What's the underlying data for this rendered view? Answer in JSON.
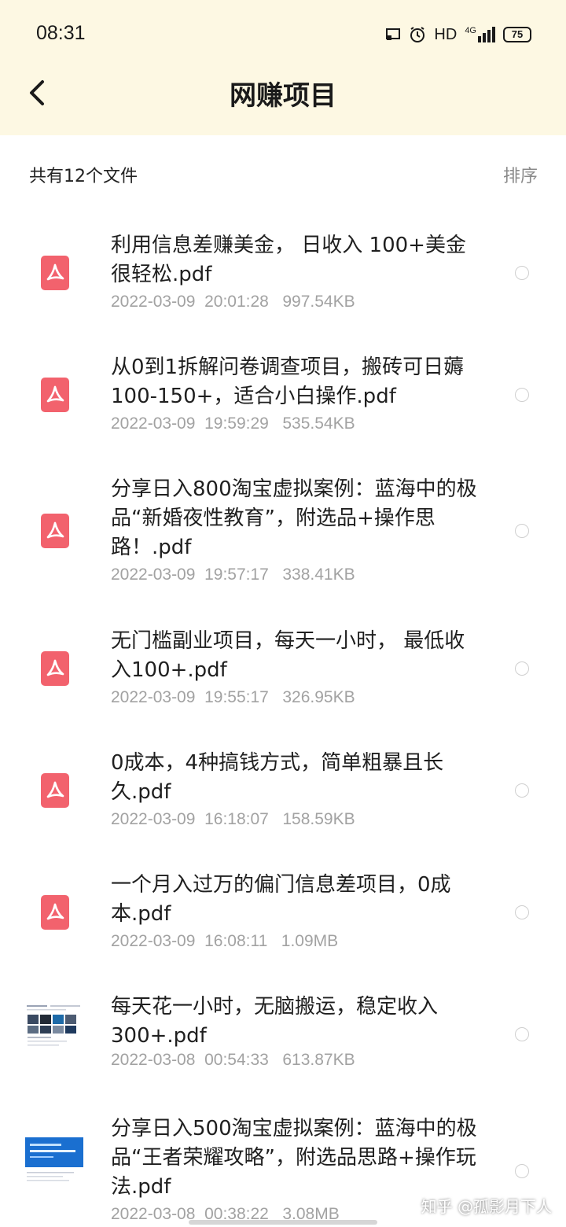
{
  "status": {
    "time": "08:31",
    "network": "HD",
    "signal": "4G",
    "battery": "75"
  },
  "header": {
    "title": "网赚项目"
  },
  "summary": {
    "count_text": "共有12个文件",
    "sort_label": "排序"
  },
  "files": [
    {
      "name": "利用信息差赚美金， 日收入 100+美金很轻松.pdf",
      "meta": "2022-03-09  20:01:28   997.54KB",
      "icon": "pdf-icon"
    },
    {
      "name": "从0到1拆解问卷调查项目，搬砖可日薅100-150+，适合小白操作.pdf",
      "meta": "2022-03-09  19:59:29   535.54KB",
      "icon": "pdf-icon"
    },
    {
      "name": "分享日入800淘宝虚拟案例：蓝海中的极品“新婚夜性教育”，附选品+操作思路！.pdf",
      "meta": "2022-03-09  19:57:17   338.41KB",
      "icon": "pdf-icon"
    },
    {
      "name": "无门槛副业项目，每天一小时， 最低收入100+.pdf",
      "meta": "2022-03-09  19:55:17   326.95KB",
      "icon": "pdf-icon"
    },
    {
      "name": "0成本，4种搞钱方式，简单粗暴且长久.pdf",
      "meta": "2022-03-09  16:18:07   158.59KB",
      "icon": "pdf-icon"
    },
    {
      "name": "一个月入过万的偏门信息差项目，0成本.pdf",
      "meta": "2022-03-09  16:08:11   1.09MB",
      "icon": "pdf-icon"
    },
    {
      "name": "每天花一小时，无脑搬运，稳定收入300+.pdf",
      "meta": "2022-03-08  00:54:33   613.87KB",
      "icon": "document-thumbnail"
    },
    {
      "name": "分享日入500淘宝虚拟案例：蓝海中的极品“王者荣耀攻略”，附选品思路+操作玩法.pdf",
      "meta": "2022-03-08  00:38:22   3.08MB",
      "icon": "document-thumbnail-blue"
    }
  ],
  "watermark": "知乎 @孤影月下人",
  "colors": {
    "header_bg": "#fdf8e3",
    "pdf_red": "#f2626d",
    "meta_gray": "#a2a2a2"
  }
}
